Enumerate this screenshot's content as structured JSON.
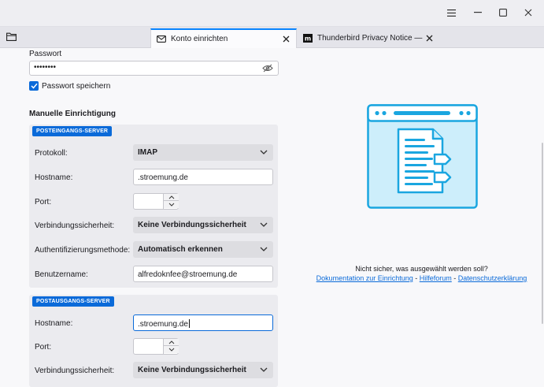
{
  "window": {
    "menu_icon": "hamburger-icon",
    "minimize_icon": "minimize-icon",
    "maximize_icon": "maximize-icon",
    "close_icon": "close-icon"
  },
  "tabs": [
    {
      "label": "Konto einrichten",
      "icon": "envelope-icon",
      "active": true
    },
    {
      "label": "Thunderbird Privacy Notice — Mozi",
      "icon": "mozilla-icon",
      "active": false
    }
  ],
  "form": {
    "password_label": "Passwort",
    "password_value": "••••••••",
    "remember_label": "Passwort speichern",
    "remember_checked": true,
    "manual_heading": "Manuelle Einrichtigung",
    "incoming": {
      "badge": "POSTEINGANGS-SERVER",
      "protocol_label": "Protokoll:",
      "protocol_value": "IMAP",
      "hostname_label": "Hostname:",
      "hostname_value": ".stroemung.de",
      "port_label": "Port:",
      "port_value": "",
      "security_label": "Verbindungssicherheit:",
      "security_value": "Keine Verbindungssicherheit",
      "auth_label": "Authentifizierungsmethode:",
      "auth_value": "Automatisch erkennen",
      "username_label": "Benutzername:",
      "username_value": "alfredoknfee@stroemung.de"
    },
    "outgoing": {
      "badge": "POSTAUSGANGS-SERVER",
      "hostname_label": "Hostname:",
      "hostname_value": ".stroemung.de",
      "port_label": "Port:",
      "port_value": "",
      "security_label": "Verbindungssicherheit:",
      "security_value": "Keine Verbindungssicherheit"
    }
  },
  "help": {
    "question": "Nicht sicher, was ausgewählt werden soll?",
    "link_docs": "Dokumentation zur Einrichtung",
    "sep1": " - ",
    "link_forum": "Hilfeforum",
    "sep2": " - ",
    "link_privacy": "Datenschutzerklärung"
  },
  "colors": {
    "accent": "#0a6ad9",
    "illustration": "#1aa6e0"
  }
}
